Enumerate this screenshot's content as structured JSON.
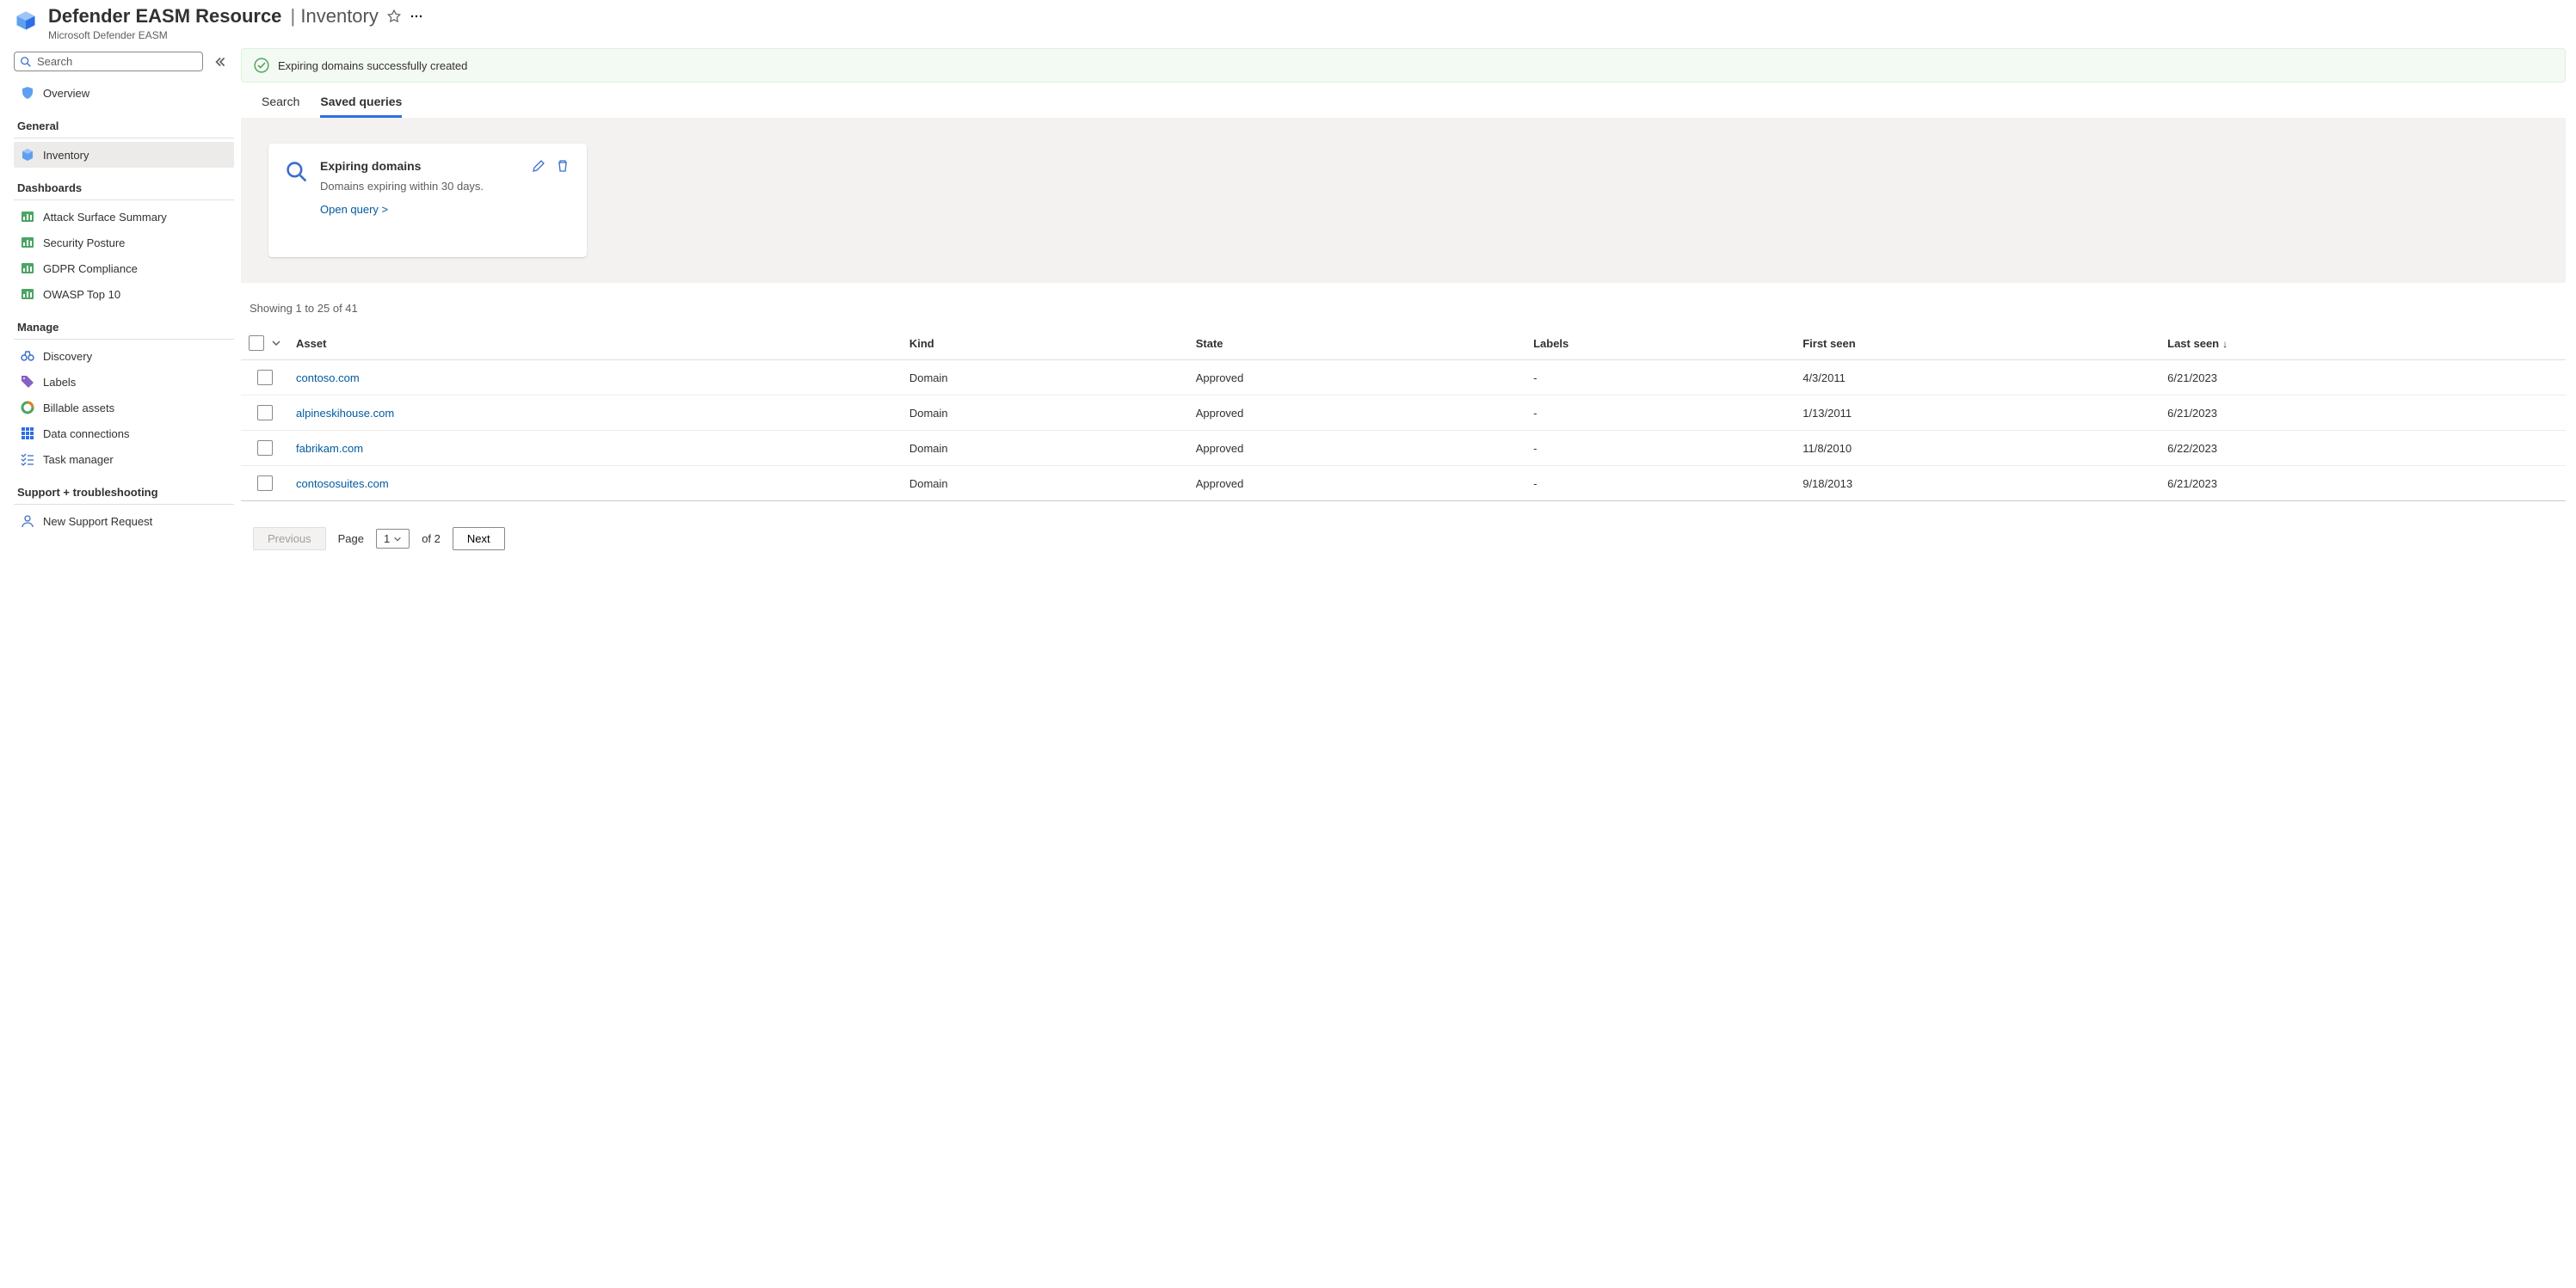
{
  "header": {
    "title": "Defender EASM Resource",
    "section": "Inventory",
    "subtitle": "Microsoft Defender EASM"
  },
  "sidebar": {
    "search_placeholder": "Search",
    "overview": "Overview",
    "sections": {
      "general": "General",
      "dashboards": "Dashboards",
      "manage": "Manage",
      "support": "Support + troubleshooting"
    },
    "items": {
      "inventory": "Inventory",
      "attack_surface": "Attack Surface Summary",
      "security_posture": "Security Posture",
      "gdpr": "GDPR Compliance",
      "owasp": "OWASP Top 10",
      "discovery": "Discovery",
      "labels": "Labels",
      "billable": "Billable assets",
      "data_conn": "Data connections",
      "task_mgr": "Task manager",
      "new_support": "New Support Request"
    }
  },
  "banner": {
    "text": "Expiring domains successfully created"
  },
  "tabs": {
    "search": "Search",
    "saved": "Saved queries"
  },
  "card": {
    "title": "Expiring domains",
    "desc": "Domains expiring within 30 days.",
    "link": "Open query >"
  },
  "results": {
    "summary": "Showing 1 to 25 of 41"
  },
  "table": {
    "headers": {
      "asset": "Asset",
      "kind": "Kind",
      "state": "State",
      "labels": "Labels",
      "first": "First seen",
      "last": "Last seen"
    },
    "rows": [
      {
        "asset": "contoso.com",
        "kind": "Domain",
        "state": "Approved",
        "labels": "-",
        "first": "4/3/2011",
        "last": "6/21/2023"
      },
      {
        "asset": "alpineskihouse.com",
        "kind": "Domain",
        "state": "Approved",
        "labels": "-",
        "first": "1/13/2011",
        "last": "6/21/2023"
      },
      {
        "asset": "fabrikam.com",
        "kind": "Domain",
        "state": "Approved",
        "labels": "-",
        "first": "11/8/2010",
        "last": "6/22/2023"
      },
      {
        "asset": "contososuites.com",
        "kind": "Domain",
        "state": "Approved",
        "labels": "-",
        "first": "9/18/2013",
        "last": "6/21/2023"
      }
    ]
  },
  "pager": {
    "previous": "Previous",
    "page_label": "Page",
    "current": "1",
    "of_label": "of 2",
    "next": "Next"
  }
}
